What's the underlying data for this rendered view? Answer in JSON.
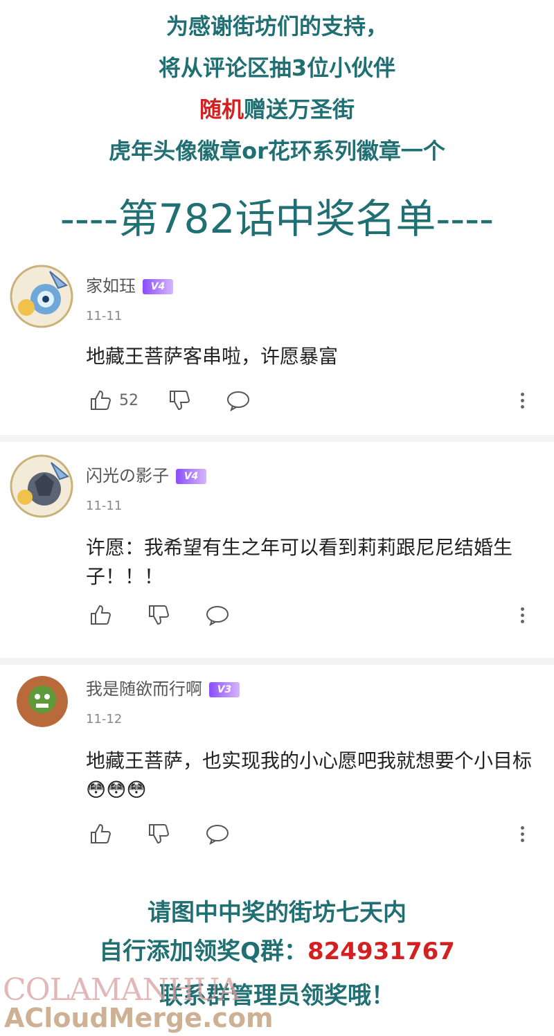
{
  "header": {
    "line1": "为感谢街坊们的支持，",
    "line2": "将从评论区抽3位小伙伴",
    "line3_red": "随机",
    "line3_rest": "赠送万圣街",
    "line4": "虎年头像徽章or花环系列徽章一个",
    "title": "----第782话中奖名单----"
  },
  "comments": [
    {
      "user": "家如珏",
      "level": "V4",
      "date": "11-11",
      "text": "地藏王菩萨客串啦，许愿暴富",
      "likes": "52"
    },
    {
      "user": "闪光の影子",
      "level": "V4",
      "date": "11-11",
      "text": "许愿：我希望有生之年可以看到莉莉跟尼尼结婚生子！！！",
      "likes": ""
    },
    {
      "user": "我是随欲而行啊",
      "level": "V3",
      "date": "11-12",
      "text": "地藏王菩萨，也实现我的小心愿吧我就想要个小目标",
      "emoji": "😳😳😳",
      "likes": ""
    }
  ],
  "footer": {
    "line1": "请图中中奖的街坊七天内",
    "line2_prefix": "自行添加领奖Q群：",
    "qq_number": "824931767",
    "line3": "联系群管理员领奖哦！"
  },
  "watermark": {
    "brand1": "COLAMANHUA",
    "brand2": "ACloudMerge.com"
  },
  "colors": {
    "teal": "#1f6f73",
    "red": "#d42020",
    "badge": "#8b4dff"
  }
}
